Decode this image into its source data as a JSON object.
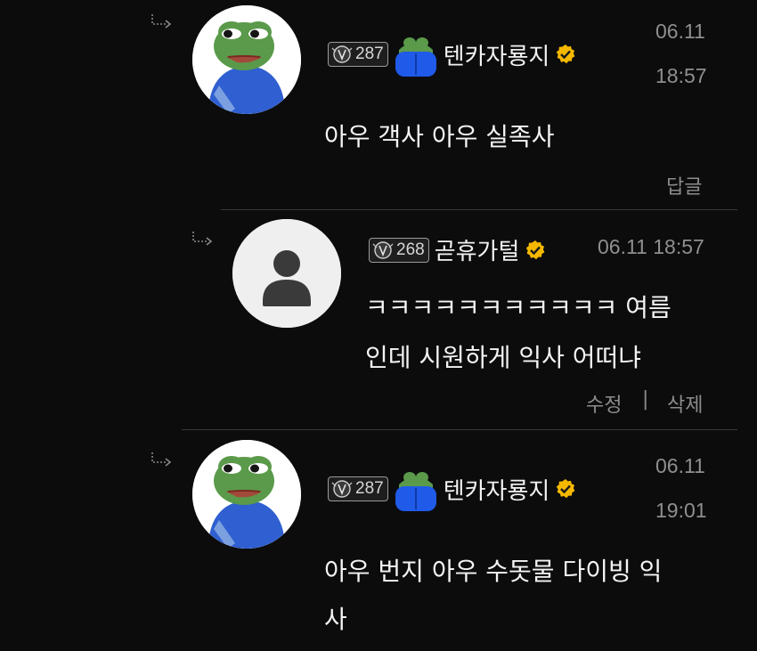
{
  "comments": [
    {
      "level": "287",
      "nickname": "텐카자룡지",
      "date": "06.11",
      "time": "18:57",
      "body": "아우 객사 아우 실족사",
      "reply_label": "답글"
    },
    {
      "level": "268",
      "nickname": "곧휴가털",
      "datetime": "06.11 18:57",
      "body_line1": "ㅋㅋㅋㅋㅋㅋㅋㅋㅋㅋㅋ 여름",
      "body_line2": "인데 시원하게 익사 어떠냐",
      "edit_label": "수정",
      "separator": "|",
      "delete_label": "삭제"
    },
    {
      "level": "287",
      "nickname": "텐카자룡지",
      "date": "06.11",
      "time": "19:01",
      "body_line1": "아우 번지 아우 수돗물 다이빙 익",
      "body_line2": "사"
    }
  ],
  "colors": {
    "background": "#0c0c0d",
    "text": "#f4f4f4",
    "muted": "#8f8f8f",
    "verified": "#f5b800",
    "divider": "#3a3a3a"
  },
  "icons": {
    "reply_arrow": "reply-arrow-icon",
    "level_badge": "level-badge-icon",
    "verified": "verified-check-icon",
    "default_avatar": "default-user-icon",
    "character_icon": "frog-character-icon"
  }
}
